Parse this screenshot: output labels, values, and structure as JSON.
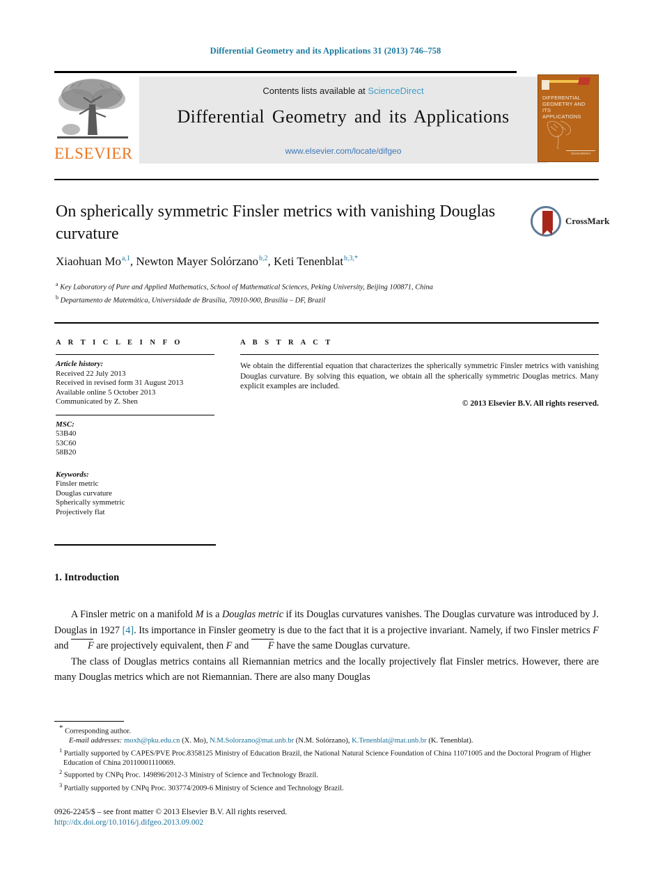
{
  "running_head": "Differential Geometry and its Applications 31 (2013) 746–758",
  "masthead": {
    "contents_prefix": "Contents lists available at ",
    "sciencedirect_link": "ScienceDirect",
    "journal_name": "Differential Geometry and its Applications",
    "journal_url": "www.elsevier.com/locate/difgeo",
    "publisher_wordmark": "ELSEVIER",
    "tree_icon": "elsevier-tree-icon",
    "cover": {
      "title_line1": "DIFFERENTIAL",
      "title_line2": "GEOMETRY AND ITS",
      "title_line3": "APPLICATIONS",
      "footer_text": "ScienceDirect",
      "background_color": "#b8651a"
    }
  },
  "article": {
    "title": "On spherically symmetric Finsler metrics with vanishing Douglas curvature",
    "crossmark_label": "CrossMark",
    "authors": [
      {
        "name": "Xiaohuan Mo",
        "marks": "a,1"
      },
      {
        "name": "Newton Mayer Solórzano",
        "marks": "b,2"
      },
      {
        "name": "Keti Tenenblat",
        "marks": "b,3,*"
      }
    ],
    "affiliations": [
      {
        "label": "a",
        "text": "Key Laboratory of Pure and Applied Mathematics, School of Mathematical Sciences, Peking University, Beijing 100871, China"
      },
      {
        "label": "b",
        "text": "Departamento de Matemática, Universidade de Brasília, 70910-900, Brasília – DF, Brazil"
      }
    ]
  },
  "info_panel": {
    "heading": "A R T I C L E    I N F O",
    "history_label": "Article history:",
    "history_lines": [
      "Received 22 July 2013",
      "Received in revised form 31 August 2013",
      "Available online 5 October 2013",
      "Communicated by Z. Shen"
    ],
    "msc_label": "MSC:",
    "msc_codes": [
      "53B40",
      "53C60",
      "58B20"
    ],
    "keywords_label": "Keywords:",
    "keywords": [
      "Finsler metric",
      "Douglas curvature",
      "Spherically symmetric",
      "Projectively flat"
    ]
  },
  "abstract_panel": {
    "heading": "A B S T R A C T",
    "text": "We obtain the differential equation that characterizes the spherically symmetric Finsler metrics with vanishing Douglas curvature. By solving this equation, we obtain all the spherically symmetric Douglas metrics. Many explicit examples are included.",
    "copyright": "© 2013 Elsevier B.V. All rights reserved."
  },
  "body": {
    "section_number": "1.",
    "section_title": "Introduction",
    "paragraph1_a": "A Finsler metric on a manifold ",
    "paragraph1_M": "M",
    "paragraph1_b": " is a ",
    "paragraph1_douglas": "Douglas metric",
    "paragraph1_c": " if its Douglas curvatures vanishes. The Douglas curvature was introduced by J. Douglas in 1927 ",
    "paragraph1_ref": "[4]",
    "paragraph1_d": ". Its importance in Finsler geometry is due to the fact that it is a projective invariant. Namely, if two Finsler metrics ",
    "paragraph1_F1": "F",
    "paragraph1_e": " and ",
    "paragraph1_Fbar1": "F",
    "paragraph1_f": " are projectively equivalent, then ",
    "paragraph1_F2": "F",
    "paragraph1_g": " and ",
    "paragraph1_Fbar2": "F",
    "paragraph1_h": " have the same Douglas curvature.",
    "paragraph2": "The class of Douglas metrics contains all Riemannian metrics and the locally projectively flat Finsler metrics. However, there are many Douglas metrics which are not Riemannian. There are also many Douglas"
  },
  "footnotes": {
    "corresponding": "Corresponding author.",
    "corresponding_mark": "*",
    "email_label": "E-mail addresses:",
    "emails": [
      {
        "address": "moxh@pku.edu.cn",
        "owner": "(X. Mo),"
      },
      {
        "address": "N.M.Solorzano@mat.unb.br",
        "owner": "(N.M. Solórzano),"
      },
      {
        "address": "K.Tenenblat@mat.unb.br",
        "owner": ""
      }
    ],
    "email_tail": "(K. Tenenblat).",
    "numbered": [
      {
        "mark": "1",
        "text": "Partially supported by CAPES/PVE Proc.8358125 Ministry of Education Brazil, the National Natural Science Foundation of China 11071005 and the Doctoral Program of Higher Education of China 20110001110069."
      },
      {
        "mark": "2",
        "text": "Supported by CNPq Proc. 149896/2012-3 Ministry of Science and Technology Brazil."
      },
      {
        "mark": "3",
        "text": "Partially supported by CNPq Proc. 303774/2009-6 Ministry of Science and Technology Brazil."
      }
    ]
  },
  "footer": {
    "front_matter": "0926-2245/$ – see front matter  © 2013 Elsevier B.V. All rights reserved.",
    "doi": "http://dx.doi.org/10.1016/j.difgeo.2013.09.002"
  },
  "colors": {
    "link_blue": "#1a7a9e",
    "sciencedirect_blue": "#3c9ecb",
    "elsevier_orange": "#E87722",
    "band_gray": "#e8e8e8"
  }
}
